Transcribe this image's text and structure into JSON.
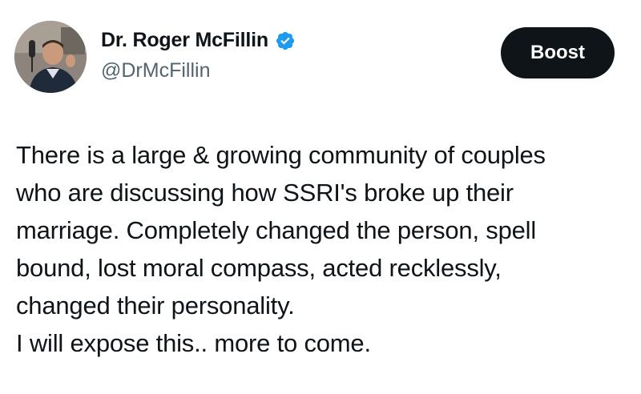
{
  "author": {
    "display_name": "Dr. Roger McFillin",
    "handle": "@DrMcFillin",
    "verified": true,
    "verified_color": "#1d9bf0"
  },
  "actions": {
    "boost_label": "Boost"
  },
  "tweet": {
    "text": "There is a large & growing community of couples\nwho are discussing how SSRI's broke up their\nmarriage. Completely changed the person, spell\nbound, lost moral compass, acted recklessly,\nchanged their personality.\n I will expose this.. more to come."
  },
  "icons": {
    "avatar": "profile-photo",
    "verified": "verified-badge-icon"
  }
}
